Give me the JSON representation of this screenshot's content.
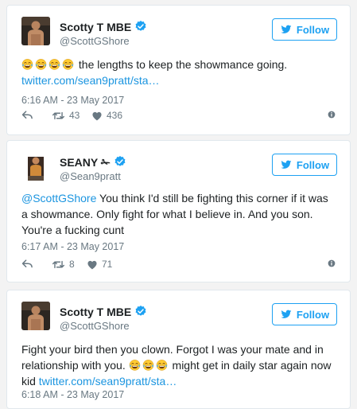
{
  "follow_label": "Follow",
  "tweets": [
    {
      "name": "Scotty T MBE",
      "handle": "@ScottGShore",
      "text_after_emoji": "the lengths to keep the showmance going.",
      "link": "twitter.com/sean9pratt/sta…",
      "timestamp": "6:16 AM - 23 May 2017",
      "retweets": "43",
      "likes": "436"
    },
    {
      "name": "SEANY ✁",
      "handle": "@Sean9pratt",
      "mention": "@ScottGShore",
      "text": "You think I'd still be fighting this corner if it was a showmance. Only fight for what I believe in. And you son. You're a fucking cunt",
      "timestamp": "6:17 AM - 23 May 2017",
      "retweets": "8",
      "likes": "71"
    },
    {
      "name": "Scotty T MBE",
      "handle": "@ScottGShore",
      "text_before_emoji": "Fight your bird then you clown. Forgot I was your mate and in relationship with you.",
      "text_after_emoji": "might get in daily star again now kid",
      "link": "twitter.com/sean9pratt/sta…",
      "timestamp": "6:18 AM - 23 May 2017"
    }
  ],
  "icons": {
    "reply": "reply-icon",
    "retweet": "retweet-icon",
    "like": "heart-icon",
    "info": "info-icon",
    "verified": "verified-badge-icon",
    "follow": "twitter-bird-icon",
    "emoji": "tears-of-joy-emoji"
  },
  "colors": {
    "accent": "#1da1f2",
    "link": "#1b95e0",
    "muted": "#697882",
    "text": "#1c2022"
  }
}
